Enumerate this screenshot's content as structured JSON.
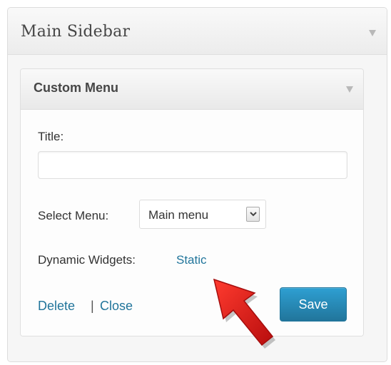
{
  "sidebar": {
    "title": "Main Sidebar",
    "toggle_icon": "triangle-down-icon"
  },
  "widget": {
    "title": "Custom Menu",
    "toggle_icon": "triangle-down-icon",
    "fields": {
      "title_label": "Title:",
      "title_value": "",
      "title_placeholder": "",
      "select_label": "Select Menu:",
      "select_value": "Main menu",
      "select_icon": "chevron-down-icon",
      "dynamic_label": "Dynamic Widgets:",
      "dynamic_link": "Static"
    },
    "actions": {
      "delete_label": "Delete",
      "separator": "|",
      "close_label": "Close",
      "save_label": "Save"
    }
  },
  "annotation": {
    "icon": "red-arrow-icon"
  },
  "colors": {
    "link": "#21759b",
    "button": "#21759b",
    "arrow": "#e51b1b"
  }
}
